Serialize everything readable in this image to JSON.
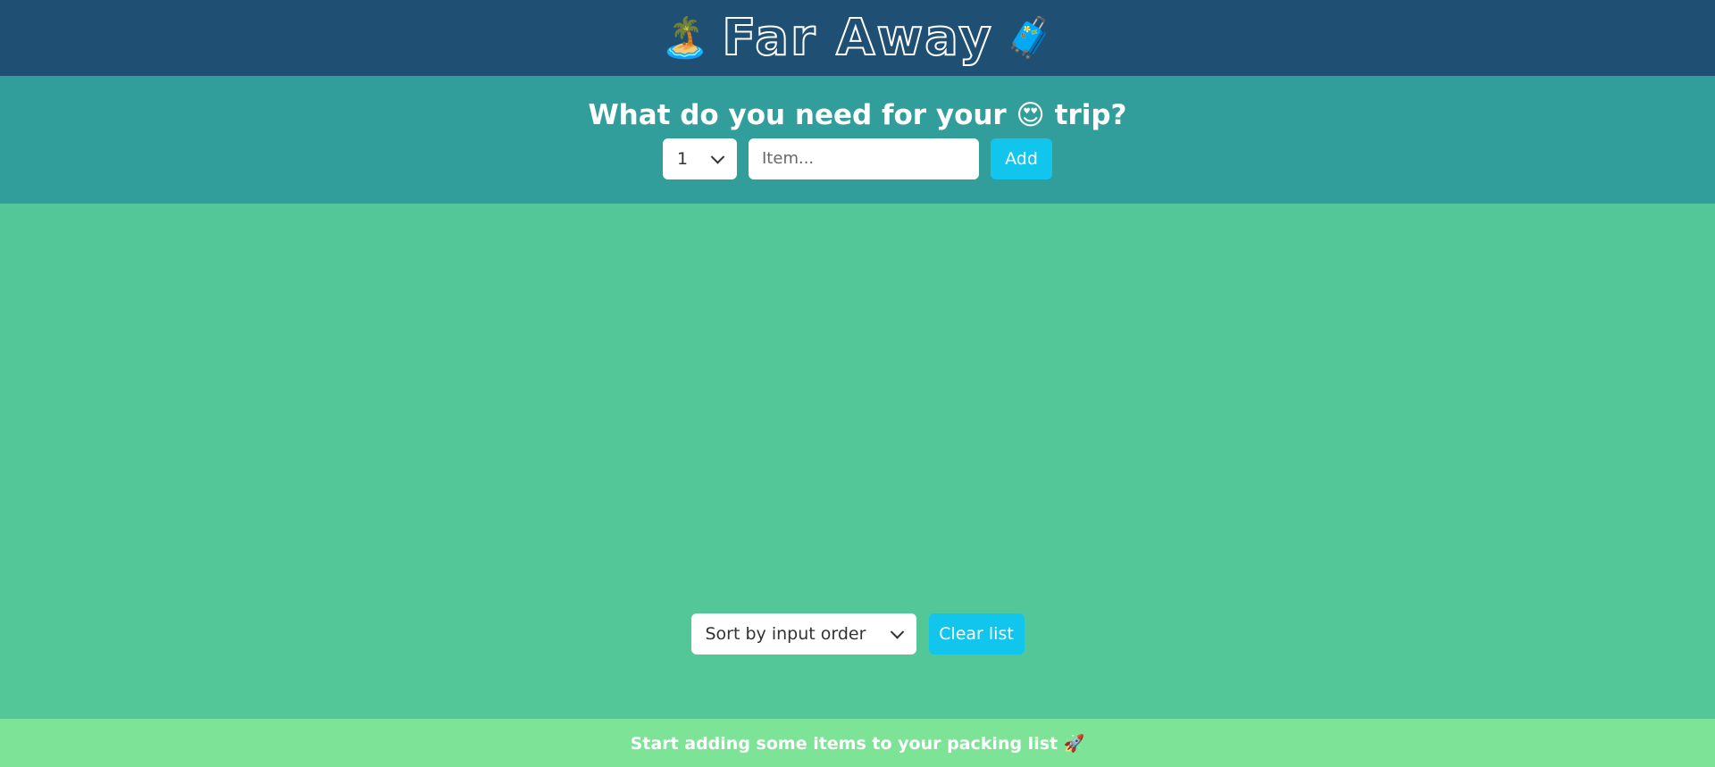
{
  "header": {
    "left_emoji": "🏝️",
    "logo": "Far Away",
    "right_emoji": "🧳"
  },
  "form": {
    "heading": "What do you need for your 😍 trip?",
    "quantity_value": "1",
    "item_placeholder": "Item...",
    "add_label": "Add"
  },
  "actions": {
    "sort_value": "Sort by input order",
    "clear_label": "Clear list"
  },
  "stats": {
    "message": "Start adding some items to your packing list 🚀"
  },
  "colors": {
    "header_bg": "#1f5073",
    "form_bg": "#329e9c",
    "list_bg": "#54c798",
    "stats_bg": "#7de497",
    "button_bg": "#12c5ec"
  }
}
